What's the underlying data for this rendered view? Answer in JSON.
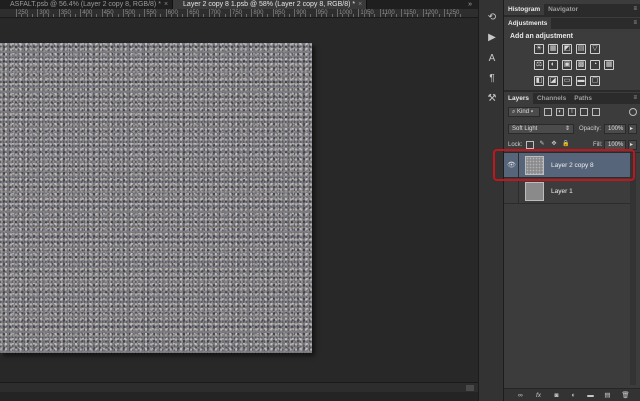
{
  "documents": {
    "tabs": [
      {
        "label": "ASFALT.psb @ 56.4% (Layer 2 copy 8, RGB/8) *",
        "close": "×",
        "active": false
      },
      {
        "label": "Layer 2 copy 8 1.psb @ 58% (Layer 2 copy 8, RGB/8) *",
        "close": "×",
        "active": true
      }
    ],
    "more": "»"
  },
  "ruler": {
    "labels": [
      "250",
      "300",
      "350",
      "400",
      "450",
      "500",
      "550",
      "600",
      "650",
      "700",
      "750",
      "800",
      "850",
      "900",
      "950",
      "1000",
      "1050",
      "1100",
      "1150",
      "1200",
      "1250"
    ]
  },
  "tools": [
    "history-brush-icon",
    "play-icon",
    "character-icon",
    "paragraph-icon",
    "tool-presets-icon"
  ],
  "top_panel": {
    "tabs": [
      {
        "label": "Histogram",
        "active": true
      },
      {
        "label": "Navigator",
        "active": false
      }
    ],
    "menu": "≡"
  },
  "adjustments": {
    "tab": "Adjustments",
    "title": "Add an adjustment",
    "row1": [
      "☀",
      "▦",
      "◩",
      "▤",
      "▽"
    ],
    "row2": [
      "⚖",
      "◐",
      "▣",
      "▩",
      "◔",
      "▦"
    ],
    "row3": [
      "◧",
      "◪",
      "▭",
      "▬",
      "▢"
    ]
  },
  "layers_panel": {
    "tabs": [
      {
        "label": "Layers",
        "active": true
      },
      {
        "label": "Channels",
        "active": false
      },
      {
        "label": "Paths",
        "active": false
      }
    ],
    "kind_label": "Kind",
    "blend_mode": "Soft Light",
    "opacity_label": "Opacity:",
    "opacity_value": "100%",
    "lock_label": "Lock:",
    "fill_label": "Fill:",
    "fill_value": "100%",
    "layers": [
      {
        "name": "Layer 2 copy 8",
        "selected": true,
        "visible": true
      },
      {
        "name": "Layer 1",
        "selected": false,
        "visible": false
      }
    ],
    "footer": [
      "link-icon",
      "fx-icon",
      "mask-icon",
      "adjustment-icon",
      "group-icon",
      "new-layer-icon",
      "trash-icon"
    ]
  },
  "colors": {
    "highlight": "#c0161d",
    "selected_row": "#56657a"
  }
}
